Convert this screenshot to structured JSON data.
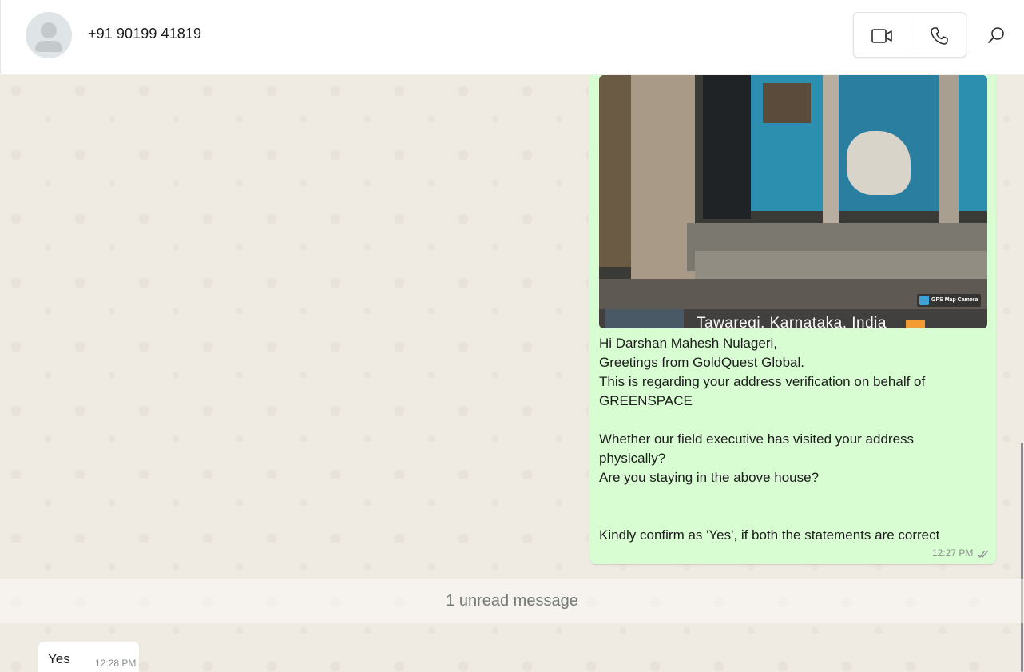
{
  "header": {
    "contact_name": "+91 90199 41819",
    "video_call_icon": "video-camera-icon",
    "voice_call_icon": "phone-icon",
    "search_icon": "search-icon"
  },
  "chat": {
    "outgoing": {
      "photo": {
        "location_text": "Tawaregi, Karnataka, India",
        "badge_text": "GPS Map Camera"
      },
      "lines": [
        "Hi Darshan Mahesh Nulageri,",
        "Greetings from GoldQuest Global.",
        "This is regarding your address verification on behalf of",
        "GREENSPACE",
        "",
        "Whether our field executive has visited your address",
        "physically?",
        "Are you staying in the above house?",
        "",
        "",
        "Kindly confirm as 'Yes', if both the statements are correct"
      ],
      "time": "12:27 PM",
      "status": "read"
    },
    "unread_banner": "1 unread message",
    "incoming": {
      "text": "Yes",
      "time": "12:28 PM"
    }
  },
  "colors": {
    "outgoing_bubble": "#d9fdd3",
    "incoming_bubble": "#ffffff",
    "chat_background": "#efeae2",
    "read_tick": "#8a8f8c"
  }
}
